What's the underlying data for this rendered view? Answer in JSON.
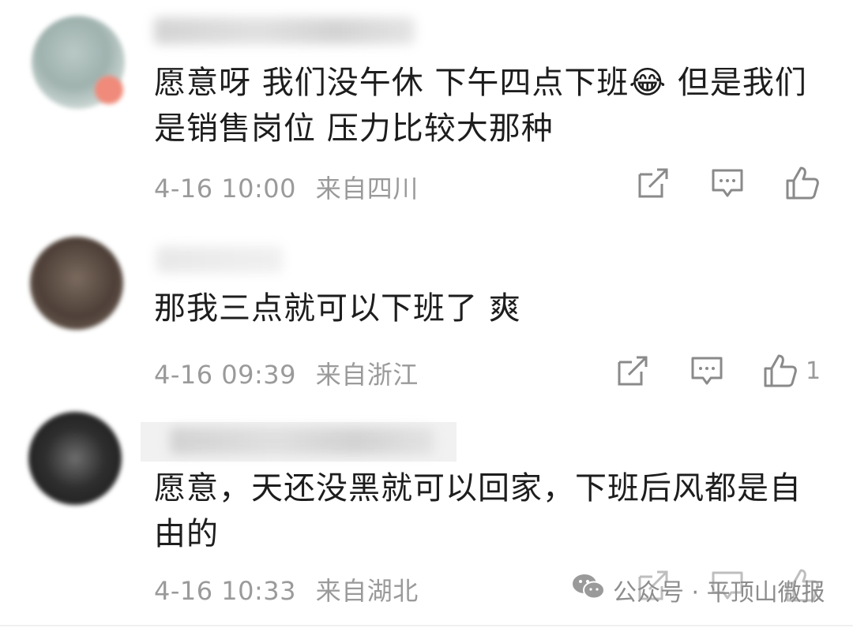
{
  "comments": [
    {
      "text": "愿意呀  我们没午休  下午四点下班😂  但是我们是销售岗位  压力比较大那种",
      "date": "4-16 10:00",
      "location": "来自四川",
      "likes": ""
    },
    {
      "text": "那我三点就可以下班了 爽",
      "date": "4-16 09:39",
      "location": "来自浙江",
      "likes": "1"
    },
    {
      "text": "愿意，天还没黑就可以回家，下班后风都是自由的",
      "date": "4-16 10:33",
      "location": "来自湖北",
      "likes": ""
    }
  ],
  "icons": {
    "share": "share-icon",
    "comment": "comment-icon",
    "like": "thumbs-up-icon",
    "wechat": "wechat-icon"
  },
  "watermark": {
    "text": "公众号 · 平顶山微报"
  }
}
